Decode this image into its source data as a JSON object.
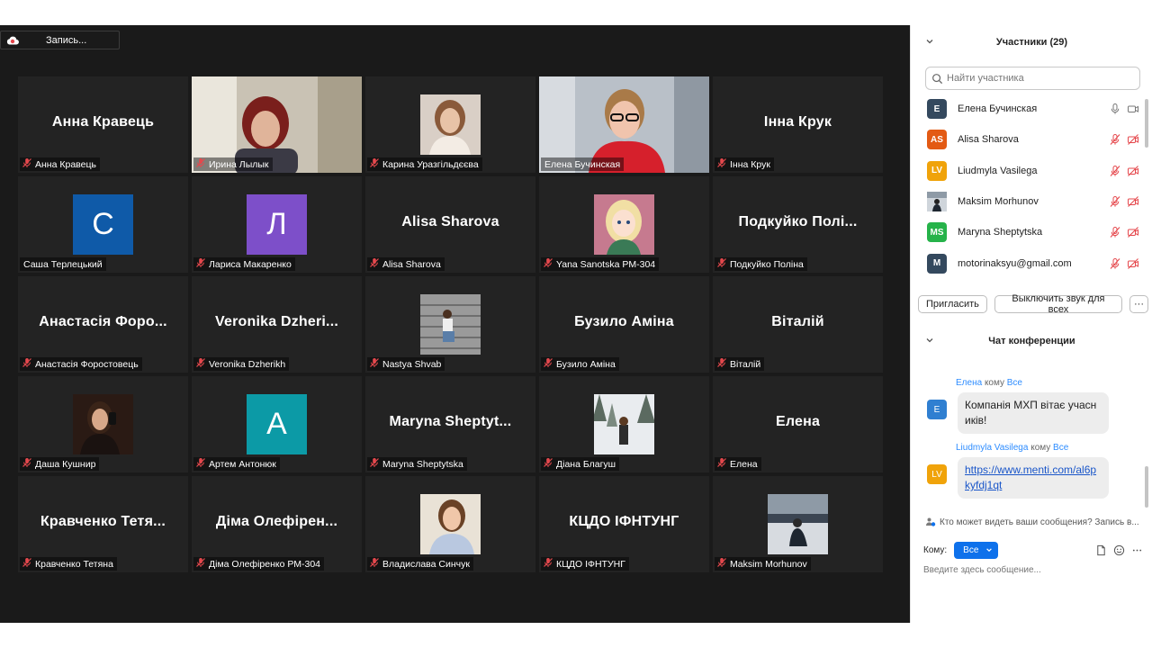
{
  "recording": {
    "label": "Запись..."
  },
  "tiles": [
    {
      "kind": "name",
      "big": "Анна Кравець",
      "label": "Анна Кравець",
      "muted": true
    },
    {
      "kind": "photo",
      "photo": "woman-red-hair-video",
      "label": "Ирина Лылык",
      "muted": true,
      "full": true
    },
    {
      "kind": "photo",
      "photo": "girl-portrait",
      "label": "Карина Уразгільдєєва",
      "muted": true
    },
    {
      "kind": "photo",
      "photo": "woman-glasses-red-sweater-video",
      "label": "Елена Бучинская",
      "muted": false,
      "full": true,
      "active": true
    },
    {
      "kind": "name",
      "big": "Інна Крук",
      "label": "Інна Крук",
      "muted": true
    },
    {
      "kind": "letter",
      "letter": "С",
      "color": "#0f5aa8",
      "label": "Саша Терлецький",
      "muted": false
    },
    {
      "kind": "letter",
      "letter": "Л",
      "color": "#7d4fc9",
      "label": "Лариса Макаренко",
      "muted": true
    },
    {
      "kind": "name",
      "big": "Alisa Sharova",
      "label": "Alisa Sharova",
      "muted": true
    },
    {
      "kind": "photo",
      "photo": "cartoon-girl",
      "label": "Yana Sanotska PM-304",
      "muted": true
    },
    {
      "kind": "name",
      "big": "Подкуйко Полі...",
      "label": "Подкуйко Поліна",
      "muted": true
    },
    {
      "kind": "name",
      "big": "Анастасія Форо...",
      "label": "Анастасія Форостовець",
      "muted": true
    },
    {
      "kind": "name",
      "big": "Veronika  Dzheri...",
      "label": "Veronika Dzherikh",
      "muted": true
    },
    {
      "kind": "photo",
      "photo": "girl-on-stairs",
      "label": "Nastya Shvab",
      "muted": true
    },
    {
      "kind": "name",
      "big": "Бузило Аміна",
      "label": "Бузило Аміна",
      "muted": true
    },
    {
      "kind": "name",
      "big": "Віталій",
      "label": "Віталій",
      "muted": true
    },
    {
      "kind": "photo",
      "photo": "girl-mirror-selfie",
      "label": "Даша Кушнир",
      "muted": true
    },
    {
      "kind": "letter",
      "letter": "А",
      "color": "#0c9aa6",
      "label": "Артем Антонюк",
      "muted": true
    },
    {
      "kind": "name",
      "big": "Maryna  Sheptyt...",
      "label": "Maryna Sheptytska",
      "muted": true
    },
    {
      "kind": "photo",
      "photo": "girl-snow-forest",
      "label": "Діана Благуш",
      "muted": true
    },
    {
      "kind": "name",
      "big": "Елена",
      "label": "Елена",
      "muted": true
    },
    {
      "kind": "name",
      "big": "Кравченко  Тетя...",
      "label": "Кравченко Тетяна",
      "muted": true
    },
    {
      "kind": "name",
      "big": "Діма  Олефірен...",
      "label": "Діма Олефіренко РМ-304",
      "muted": true
    },
    {
      "kind": "photo",
      "photo": "girl-smiling-outdoors",
      "label": "Владислава Синчук",
      "muted": true
    },
    {
      "kind": "name",
      "big": "КЦДО ІФНТУНГ",
      "label": "КЦДО ІФНТУНГ",
      "muted": true
    },
    {
      "kind": "photo",
      "photo": "man-sitting-on-snow",
      "label": "Maksim Morhunov",
      "muted": true
    }
  ],
  "participants_panel": {
    "title": "Участники (29)",
    "search_placeholder": "Найти участника",
    "list": [
      {
        "initials": "Е",
        "color": "#34495e",
        "name": "Елена Бучинская",
        "mic_on": true,
        "cam_on": true
      },
      {
        "initials": "AS",
        "color": "#e35a14",
        "name": "Alisa Sharova",
        "mic_on": false,
        "cam_on": false
      },
      {
        "initials": "LV",
        "color": "#f0a30a",
        "name": "Liudmyla Vasilega",
        "mic_on": false,
        "cam_on": false
      },
      {
        "initials": "",
        "color": "#8a8f96",
        "name": "Maksim Morhunov",
        "mic_on": false,
        "cam_on": false,
        "photo": true
      },
      {
        "initials": "MS",
        "color": "#26b34a",
        "name": "Maryna Sheptytska",
        "mic_on": false,
        "cam_on": false
      },
      {
        "initials": "M",
        "color": "#34495e",
        "name": "motorinaksyu@gmail.com",
        "mic_on": false,
        "cam_on": false
      }
    ],
    "invite_label": "Пригласить",
    "mute_all_label": "Выключить звук для всех",
    "more_label": "···"
  },
  "chat_panel": {
    "title": "Чат конференции",
    "messages": [
      {
        "sender": "Елена",
        "to_word": "кому",
        "to": "Все",
        "initials": "Е",
        "color": "#2f7fd1",
        "text": "Компанія МХП вітає учасників!",
        "is_link": false
      },
      {
        "sender": "Liudmyla Vasilega",
        "to_word": "кому",
        "to": "Все",
        "initials": "LV",
        "color": "#f0a30a",
        "text": "https://www.menti.com/al6pkyfdj1qt",
        "is_link": true
      }
    ],
    "visibility_note": "Кто может видеть ваши сообщения? Запись в...",
    "to_label": "Кому:",
    "to_value": "Все",
    "input_placeholder": "Введите здесь сообщение..."
  },
  "colors": {
    "stage": "#1a1a1a",
    "tile": "#232323",
    "active_outline": "#d3e35a",
    "accent": "#0e71eb",
    "muted_icon": "#e5484d"
  }
}
